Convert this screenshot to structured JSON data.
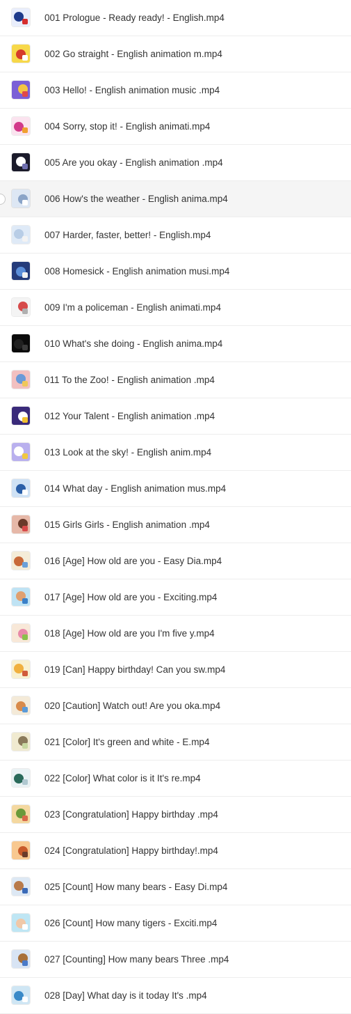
{
  "files": [
    {
      "name": "001 Prologue - Ready ready! - English.mp4",
      "thumb_colors": [
        "#e9eefc",
        "#1f3b8c",
        "#d62d2d"
      ]
    },
    {
      "name": "002 Go straight - English animation m.mp4",
      "thumb_colors": [
        "#f7d84a",
        "#d63b2b",
        "#ffffff"
      ]
    },
    {
      "name": "003 Hello! - English animation music .mp4",
      "thumb_colors": [
        "#7b5fd6",
        "#f4c542",
        "#e04848"
      ]
    },
    {
      "name": "004 Sorry, stop it! - English animati.mp4",
      "thumb_colors": [
        "#fbe3ef",
        "#d23a8a",
        "#f0a030"
      ]
    },
    {
      "name": "005 Are you okay - English animation .mp4",
      "thumb_colors": [
        "#1b1b2b",
        "#ffffff",
        "#6f6fb0"
      ]
    },
    {
      "name": "006 How's the weather - English anima.mp4",
      "thumb_colors": [
        "#dde7f4",
        "#8aa4c8",
        "#ffffff"
      ]
    },
    {
      "name": "007 Harder, faster, better! - English.mp4",
      "thumb_colors": [
        "#dfeaf7",
        "#b8cde6",
        "#f3f3f3"
      ]
    },
    {
      "name": "008 Homesick - English animation musi.mp4",
      "thumb_colors": [
        "#243b7a",
        "#5b8ed8",
        "#f2f2f2"
      ]
    },
    {
      "name": "009 I'm a policeman - English animati.mp4",
      "thumb_colors": [
        "#f4f4f4",
        "#d64a4a",
        "#b0b0b0"
      ]
    },
    {
      "name": "010 What's she doing - English anima.mp4",
      "thumb_colors": [
        "#0b0b0b",
        "#202020",
        "#3a3a3a"
      ]
    },
    {
      "name": "011 To the Zoo! - English animation .mp4",
      "thumb_colors": [
        "#f2c0c0",
        "#6a9ad8",
        "#f0c85a"
      ]
    },
    {
      "name": "012 Your Talent - English animation .mp4",
      "thumb_colors": [
        "#3a2a7a",
        "#ffffff",
        "#f0c030"
      ]
    },
    {
      "name": "013 Look at the sky! - English anim.mp4",
      "thumb_colors": [
        "#b9b0ee",
        "#ffffff",
        "#f0c840"
      ]
    },
    {
      "name": "014 What day - English animation mus.mp4",
      "thumb_colors": [
        "#cfe2f5",
        "#2a5fa8",
        "#ffffff"
      ]
    },
    {
      "name": "015 Girls Girls - English animation .mp4",
      "thumb_colors": [
        "#e6b8a8",
        "#6a3a2a",
        "#d84a4a"
      ]
    },
    {
      "name": "016 [Age] How old are you - Easy Dia.mp4",
      "thumb_colors": [
        "#f4ecd8",
        "#c86a3a",
        "#6aa0d8"
      ]
    },
    {
      "name": "017 [Age] How old are you - Exciting.mp4",
      "thumb_colors": [
        "#bfe3f4",
        "#e0a070",
        "#3a80c8"
      ]
    },
    {
      "name": "018 [Age] How old are you I'm five y.mp4",
      "thumb_colors": [
        "#f8e8d8",
        "#e88aa8",
        "#8ac04a"
      ]
    },
    {
      "name": "019 [Can] Happy birthday! Can you sw.mp4",
      "thumb_colors": [
        "#f8f0d0",
        "#f0b040",
        "#d05a3a"
      ]
    },
    {
      "name": "020 [Caution] Watch out! Are you oka.mp4",
      "thumb_colors": [
        "#f4ead8",
        "#d88a4a",
        "#5a9ad8"
      ]
    },
    {
      "name": "021 [Color] It's green and white - E.mp4",
      "thumb_colors": [
        "#f0ead0",
        "#8a7a5a",
        "#c8d8a0"
      ]
    },
    {
      "name": "022 [Color] What color is it It's re.mp4",
      "thumb_colors": [
        "#eaf2f4",
        "#2a6a5a",
        "#b0c8d0"
      ]
    },
    {
      "name": "023 [Congratulation] Happy birthday .mp4",
      "thumb_colors": [
        "#f4d8a0",
        "#6a9a3a",
        "#d86a4a"
      ]
    },
    {
      "name": "024 [Congratulation] Happy birthday!.mp4",
      "thumb_colors": [
        "#f8c890",
        "#c85a2a",
        "#6a3a2a"
      ]
    },
    {
      "name": "025 [Count] How many bears - Easy Di.mp4",
      "thumb_colors": [
        "#dde8f4",
        "#b87a4a",
        "#3a6ab8"
      ]
    },
    {
      "name": "026 [Count] How many tigers - Exciti.mp4",
      "thumb_colors": [
        "#bfe6f4",
        "#f0c8a8",
        "#ffffff"
      ]
    },
    {
      "name": "027 [Counting] How many bears Three .mp4",
      "thumb_colors": [
        "#d8e4f4",
        "#a8703a",
        "#4a7ac8"
      ]
    },
    {
      "name": "028 [Day] What day is it today It's .mp4",
      "thumb_colors": [
        "#cfe6f4",
        "#3a8ac8",
        "#ffffff"
      ]
    }
  ],
  "hovered_index": 5
}
